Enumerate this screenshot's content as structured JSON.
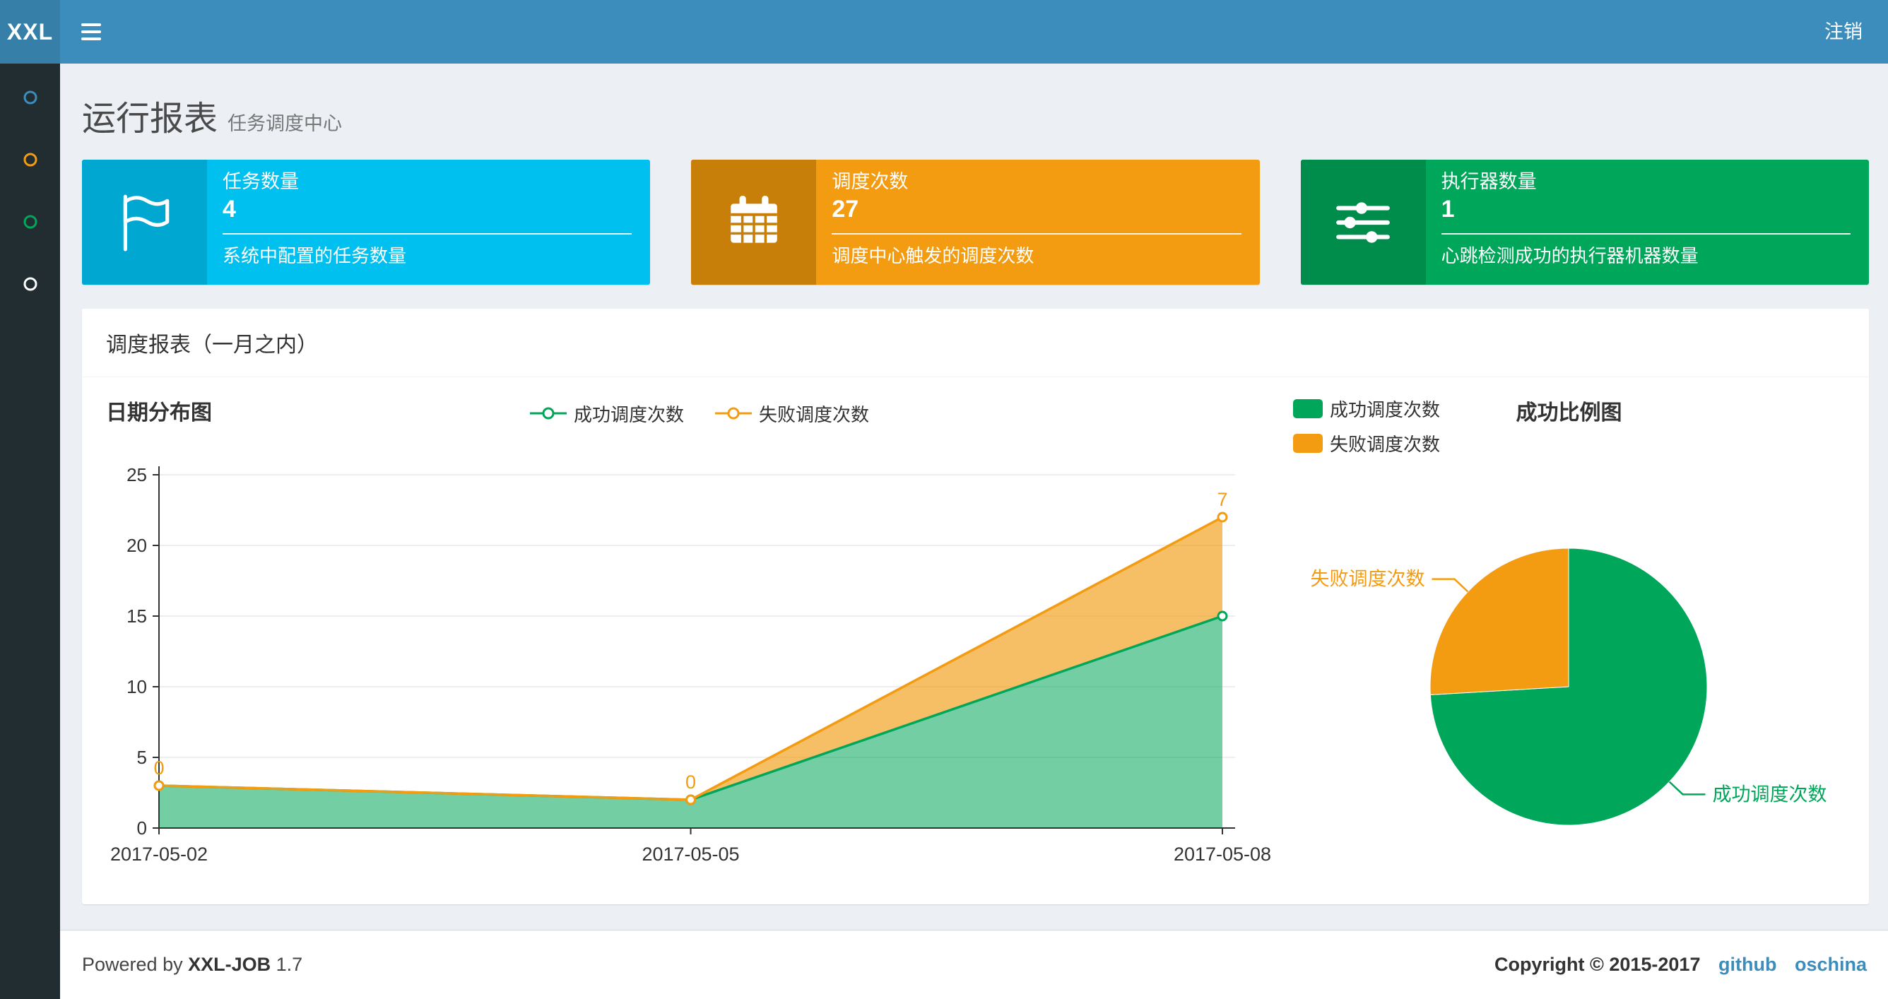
{
  "navbar": {
    "logo": "XXL",
    "logout": "注销"
  },
  "colors": {
    "navbar": "#3c8dbc",
    "logo_bg": "#367fa9",
    "sidebar": "#222d32",
    "content_bg": "#ecf0f5",
    "success": "#00a65a",
    "fail": "#f39c12",
    "aqua": "#00c0ef"
  },
  "sidebar": {
    "items": [
      {
        "icon": "circle-o-icon",
        "color": "#3c8dbc"
      },
      {
        "icon": "circle-o-icon",
        "color": "#f39c12"
      },
      {
        "icon": "circle-o-icon",
        "color": "#00a65a"
      },
      {
        "icon": "circle-o-icon",
        "color": "#ffffff"
      }
    ]
  },
  "header": {
    "title": "运行报表",
    "subtitle": "任务调度中心"
  },
  "info_boxes": [
    {
      "title": "任务数量",
      "value": "4",
      "desc": "系统中配置的任务数量",
      "icon": "flag-icon",
      "bg": "#00c0ef",
      "icon_bg": "#00a7d0"
    },
    {
      "title": "调度次数",
      "value": "27",
      "desc": "调度中心触发的调度次数",
      "icon": "calendar-icon",
      "bg": "#f39c12",
      "icon_bg": "#c87f0a"
    },
    {
      "title": "执行器数量",
      "value": "1",
      "desc": "心跳检测成功的执行器机器数量",
      "icon": "sliders-icon",
      "bg": "#00a65a",
      "icon_bg": "#008d4c"
    }
  ],
  "panel": {
    "title": "调度报表（一月之内）"
  },
  "chart_data": [
    {
      "type": "area",
      "title": "日期分布图",
      "x": [
        "2017-05-02",
        "2017-05-05",
        "2017-05-08"
      ],
      "series": [
        {
          "name": "成功调度次数",
          "values": [
            3,
            2,
            15
          ],
          "color": "#00a65a"
        },
        {
          "name": "失败调度次数",
          "values": [
            0,
            0,
            7
          ],
          "color": "#f39c12",
          "show_labels": true
        }
      ],
      "stacked": true,
      "ylim": [
        0,
        25
      ],
      "yticks": [
        0,
        5,
        10,
        15,
        20,
        25
      ],
      "grid": true,
      "legend_position": "top-center"
    },
    {
      "type": "pie",
      "title": "成功比例图",
      "slices": [
        {
          "name": "成功调度次数",
          "value": 20,
          "color": "#00a65a"
        },
        {
          "name": "失败调度次数",
          "value": 7,
          "color": "#f39c12"
        }
      ],
      "legend_position": "top-left",
      "start_angle_deg_from_top": 0,
      "direction": "clockwise"
    }
  ],
  "footer": {
    "powered_prefix": "Powered by",
    "brand": "XXL-JOB",
    "version": "1.7",
    "copyright": "Copyright © 2015-2017",
    "links": [
      {
        "label": "github"
      },
      {
        "label": "oschina"
      }
    ]
  }
}
